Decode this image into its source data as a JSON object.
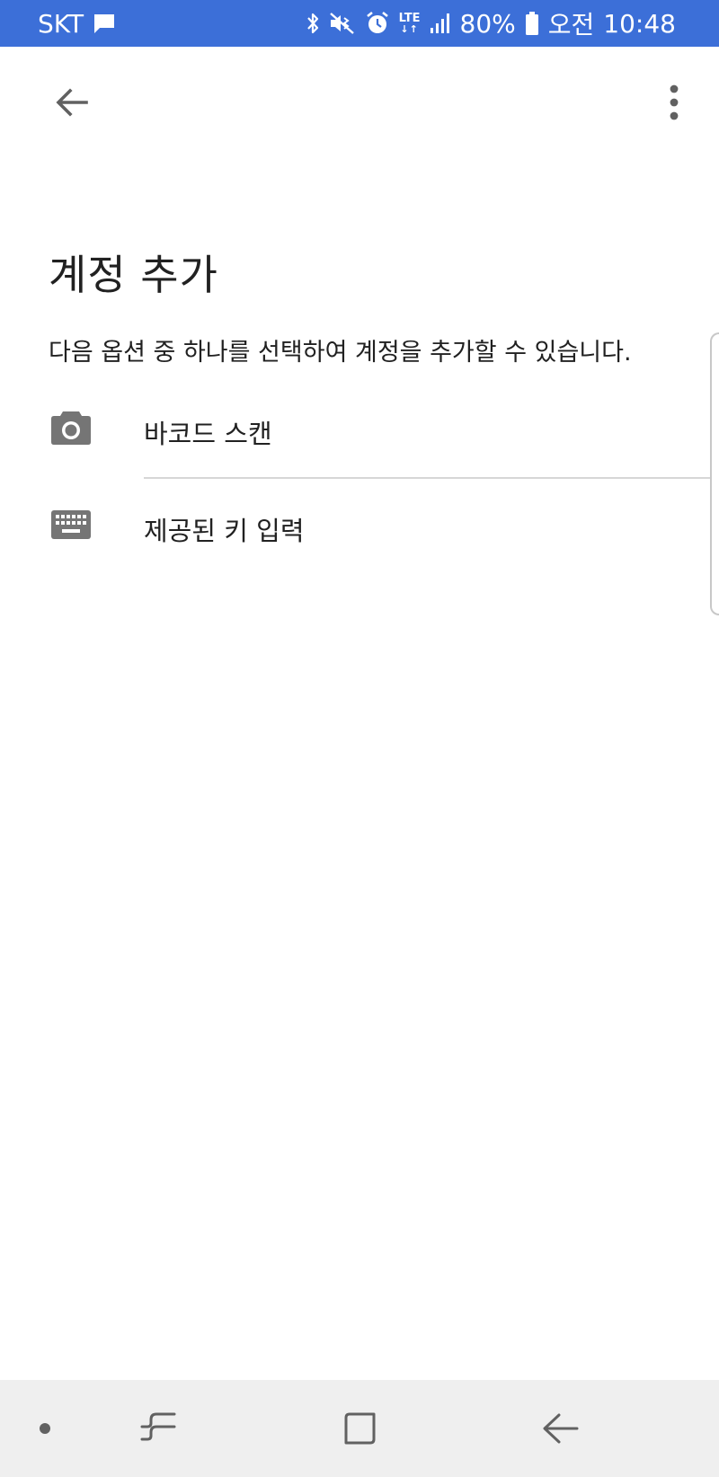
{
  "status_bar": {
    "carrier": "SKT",
    "network": "LTE",
    "battery": "80%",
    "ampm": "오전",
    "time": "10:48",
    "icons": [
      "message-icon",
      "bluetooth-icon",
      "mute-icon",
      "alarm-icon",
      "lte-icon",
      "signal-icon",
      "battery-icon"
    ],
    "background_color": "#3c6fd8"
  },
  "app_bar": {
    "back_icon": "arrow-back-icon",
    "menu_icon": "more-vert-icon"
  },
  "content": {
    "title": "계정 추가",
    "subtitle": "다음 옵션 중 하나를 선택하여 계정을 추가할 수 있습니다.",
    "options": [
      {
        "label": "바코드 스캔",
        "icon": "camera-icon"
      },
      {
        "label": "제공된 키 입력",
        "icon": "keyboard-icon"
      }
    ]
  },
  "nav_bar": {
    "buttons": [
      "nav-dot-icon",
      "recent-apps-icon",
      "home-icon",
      "nav-back-icon"
    ],
    "background_color": "#efefef"
  }
}
